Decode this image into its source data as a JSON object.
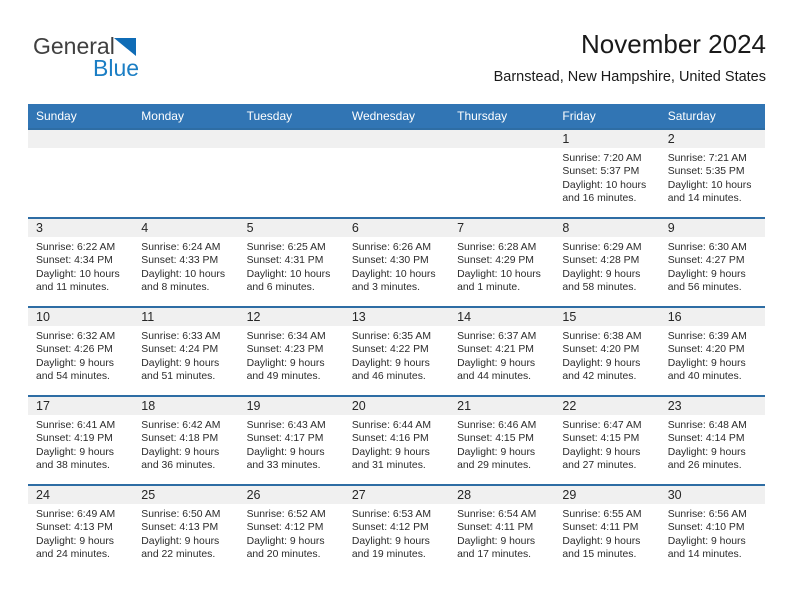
{
  "brand": {
    "name_top": "General",
    "name_bottom": "Blue",
    "triangle_color": "#0f6cb6",
    "blue_color": "#1b7ec4"
  },
  "header": {
    "title": "November 2024",
    "subtitle": "Barnstead, New Hampshire, United States"
  },
  "theme": {
    "header_blue": "#3175b4",
    "row_border_blue": "#2e6da4",
    "daynum_band": "#f0f0f0"
  },
  "weekdays": [
    "Sunday",
    "Monday",
    "Tuesday",
    "Wednesday",
    "Thursday",
    "Friday",
    "Saturday"
  ],
  "weeks": [
    [
      {
        "day": "",
        "empty": true
      },
      {
        "day": "",
        "empty": true
      },
      {
        "day": "",
        "empty": true
      },
      {
        "day": "",
        "empty": true
      },
      {
        "day": "",
        "empty": true
      },
      {
        "day": "1",
        "sunrise": "Sunrise: 7:20 AM",
        "sunset": "Sunset: 5:37 PM",
        "daylight": "Daylight: 10 hours and 16 minutes."
      },
      {
        "day": "2",
        "sunrise": "Sunrise: 7:21 AM",
        "sunset": "Sunset: 5:35 PM",
        "daylight": "Daylight: 10 hours and 14 minutes."
      }
    ],
    [
      {
        "day": "3",
        "sunrise": "Sunrise: 6:22 AM",
        "sunset": "Sunset: 4:34 PM",
        "daylight": "Daylight: 10 hours and 11 minutes."
      },
      {
        "day": "4",
        "sunrise": "Sunrise: 6:24 AM",
        "sunset": "Sunset: 4:33 PM",
        "daylight": "Daylight: 10 hours and 8 minutes."
      },
      {
        "day": "5",
        "sunrise": "Sunrise: 6:25 AM",
        "sunset": "Sunset: 4:31 PM",
        "daylight": "Daylight: 10 hours and 6 minutes."
      },
      {
        "day": "6",
        "sunrise": "Sunrise: 6:26 AM",
        "sunset": "Sunset: 4:30 PM",
        "daylight": "Daylight: 10 hours and 3 minutes."
      },
      {
        "day": "7",
        "sunrise": "Sunrise: 6:28 AM",
        "sunset": "Sunset: 4:29 PM",
        "daylight": "Daylight: 10 hours and 1 minute."
      },
      {
        "day": "8",
        "sunrise": "Sunrise: 6:29 AM",
        "sunset": "Sunset: 4:28 PM",
        "daylight": "Daylight: 9 hours and 58 minutes."
      },
      {
        "day": "9",
        "sunrise": "Sunrise: 6:30 AM",
        "sunset": "Sunset: 4:27 PM",
        "daylight": "Daylight: 9 hours and 56 minutes."
      }
    ],
    [
      {
        "day": "10",
        "sunrise": "Sunrise: 6:32 AM",
        "sunset": "Sunset: 4:26 PM",
        "daylight": "Daylight: 9 hours and 54 minutes."
      },
      {
        "day": "11",
        "sunrise": "Sunrise: 6:33 AM",
        "sunset": "Sunset: 4:24 PM",
        "daylight": "Daylight: 9 hours and 51 minutes."
      },
      {
        "day": "12",
        "sunrise": "Sunrise: 6:34 AM",
        "sunset": "Sunset: 4:23 PM",
        "daylight": "Daylight: 9 hours and 49 minutes."
      },
      {
        "day": "13",
        "sunrise": "Sunrise: 6:35 AM",
        "sunset": "Sunset: 4:22 PM",
        "daylight": "Daylight: 9 hours and 46 minutes."
      },
      {
        "day": "14",
        "sunrise": "Sunrise: 6:37 AM",
        "sunset": "Sunset: 4:21 PM",
        "daylight": "Daylight: 9 hours and 44 minutes."
      },
      {
        "day": "15",
        "sunrise": "Sunrise: 6:38 AM",
        "sunset": "Sunset: 4:20 PM",
        "daylight": "Daylight: 9 hours and 42 minutes."
      },
      {
        "day": "16",
        "sunrise": "Sunrise: 6:39 AM",
        "sunset": "Sunset: 4:20 PM",
        "daylight": "Daylight: 9 hours and 40 minutes."
      }
    ],
    [
      {
        "day": "17",
        "sunrise": "Sunrise: 6:41 AM",
        "sunset": "Sunset: 4:19 PM",
        "daylight": "Daylight: 9 hours and 38 minutes."
      },
      {
        "day": "18",
        "sunrise": "Sunrise: 6:42 AM",
        "sunset": "Sunset: 4:18 PM",
        "daylight": "Daylight: 9 hours and 36 minutes."
      },
      {
        "day": "19",
        "sunrise": "Sunrise: 6:43 AM",
        "sunset": "Sunset: 4:17 PM",
        "daylight": "Daylight: 9 hours and 33 minutes."
      },
      {
        "day": "20",
        "sunrise": "Sunrise: 6:44 AM",
        "sunset": "Sunset: 4:16 PM",
        "daylight": "Daylight: 9 hours and 31 minutes."
      },
      {
        "day": "21",
        "sunrise": "Sunrise: 6:46 AM",
        "sunset": "Sunset: 4:15 PM",
        "daylight": "Daylight: 9 hours and 29 minutes."
      },
      {
        "day": "22",
        "sunrise": "Sunrise: 6:47 AM",
        "sunset": "Sunset: 4:15 PM",
        "daylight": "Daylight: 9 hours and 27 minutes."
      },
      {
        "day": "23",
        "sunrise": "Sunrise: 6:48 AM",
        "sunset": "Sunset: 4:14 PM",
        "daylight": "Daylight: 9 hours and 26 minutes."
      }
    ],
    [
      {
        "day": "24",
        "sunrise": "Sunrise: 6:49 AM",
        "sunset": "Sunset: 4:13 PM",
        "daylight": "Daylight: 9 hours and 24 minutes."
      },
      {
        "day": "25",
        "sunrise": "Sunrise: 6:50 AM",
        "sunset": "Sunset: 4:13 PM",
        "daylight": "Daylight: 9 hours and 22 minutes."
      },
      {
        "day": "26",
        "sunrise": "Sunrise: 6:52 AM",
        "sunset": "Sunset: 4:12 PM",
        "daylight": "Daylight: 9 hours and 20 minutes."
      },
      {
        "day": "27",
        "sunrise": "Sunrise: 6:53 AM",
        "sunset": "Sunset: 4:12 PM",
        "daylight": "Daylight: 9 hours and 19 minutes."
      },
      {
        "day": "28",
        "sunrise": "Sunrise: 6:54 AM",
        "sunset": "Sunset: 4:11 PM",
        "daylight": "Daylight: 9 hours and 17 minutes."
      },
      {
        "day": "29",
        "sunrise": "Sunrise: 6:55 AM",
        "sunset": "Sunset: 4:11 PM",
        "daylight": "Daylight: 9 hours and 15 minutes."
      },
      {
        "day": "30",
        "sunrise": "Sunrise: 6:56 AM",
        "sunset": "Sunset: 4:10 PM",
        "daylight": "Daylight: 9 hours and 14 minutes."
      }
    ]
  ]
}
